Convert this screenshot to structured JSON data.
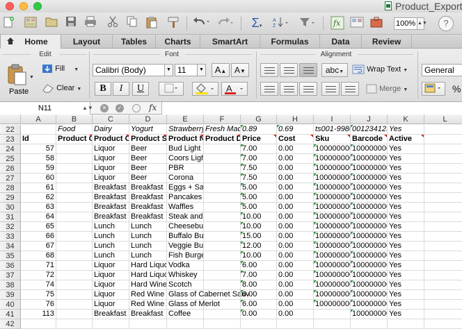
{
  "window": {
    "title": "Product_Export"
  },
  "toolbar": {
    "zoom": "100%"
  },
  "ribbon": {
    "tabs": [
      "Home",
      "Layout",
      "Tables",
      "Charts",
      "SmartArt",
      "Formulas",
      "Data",
      "Review"
    ],
    "active_tab": "Home",
    "edit": {
      "group": "Edit",
      "paste": "Paste",
      "fill": "Fill",
      "clear": "Clear"
    },
    "font": {
      "group": "Font",
      "name": "Calibri (Body)",
      "size": "11",
      "bold": "B",
      "italic": "I",
      "underline": "U"
    },
    "alignment": {
      "group": "Alignment",
      "orientation": "abc",
      "wrap_text": "Wrap Text",
      "merge": "Merge"
    },
    "number": {
      "format": "General",
      "percent": "%"
    }
  },
  "formula_bar": {
    "cell_ref": "N11",
    "formula": ""
  },
  "sheet": {
    "columns": [
      "A",
      "B",
      "C",
      "D",
      "E",
      "F",
      "G",
      "H",
      "I",
      "J",
      "K",
      "L"
    ],
    "rows": [
      {
        "n": "22",
        "cells": [
          "",
          "Food",
          "Dairy",
          "Yogurt",
          "Strawberry",
          "Fresh Made",
          "0.89",
          "0.69",
          "ts001-9980",
          "001234123",
          "Yes",
          ""
        ]
      },
      {
        "n": "23",
        "cells": [
          "Id",
          "Product Cl",
          "Product Ca",
          "Product Su",
          "Product Na",
          "Product De",
          "Price",
          "Cost",
          "Sku",
          "Barcode",
          "Active",
          ""
        ]
      },
      {
        "n": "24",
        "cells": [
          "57",
          "",
          "Liquor",
          "Beer",
          "Bud Light",
          "",
          "7.00",
          "0.00",
          "100000000",
          "100000000",
          "Yes",
          ""
        ]
      },
      {
        "n": "25",
        "cells": [
          "58",
          "",
          "Liquor",
          "Beer",
          "Coors Light",
          "",
          "7.00",
          "0.00",
          "100000000",
          "100000000",
          "Yes",
          ""
        ]
      },
      {
        "n": "26",
        "cells": [
          "59",
          "",
          "Liquor",
          "Beer",
          "PBR",
          "",
          "7.50",
          "0.00",
          "100000000",
          "100000000",
          "Yes",
          ""
        ]
      },
      {
        "n": "27",
        "cells": [
          "60",
          "",
          "Liquor",
          "Beer",
          "Corona",
          "",
          "7.50",
          "0.00",
          "100000000",
          "100000000",
          "Yes",
          ""
        ]
      },
      {
        "n": "28",
        "cells": [
          "61",
          "",
          "Breakfast",
          "Breakfast",
          "Eggs + Sausage",
          "",
          "5.00",
          "0.00",
          "100000000",
          "100000000",
          "Yes",
          ""
        ]
      },
      {
        "n": "29",
        "cells": [
          "62",
          "",
          "Breakfast",
          "Breakfast",
          "Pancakes",
          "",
          "5.00",
          "0.00",
          "100000000",
          "100000000",
          "Yes",
          ""
        ]
      },
      {
        "n": "30",
        "cells": [
          "63",
          "",
          "Breakfast",
          "Breakfast",
          "Waffles",
          "",
          "5.00",
          "0.00",
          "100000000",
          "100000000",
          "Yes",
          ""
        ]
      },
      {
        "n": "31",
        "cells": [
          "64",
          "",
          "Breakfast",
          "Breakfast",
          "Steak and Eggs",
          "",
          "10.00",
          "0.00",
          "100000000",
          "100000000",
          "Yes",
          ""
        ]
      },
      {
        "n": "32",
        "cells": [
          "65",
          "",
          "Lunch",
          "Lunch",
          "Cheeseburger",
          "",
          "10.00",
          "0.00",
          "100000000",
          "100000000",
          "Yes",
          ""
        ]
      },
      {
        "n": "33",
        "cells": [
          "66",
          "",
          "Lunch",
          "Lunch",
          "Buffalo Burger",
          "",
          "15.00",
          "0.00",
          "100000000",
          "100000000",
          "Yes",
          ""
        ]
      },
      {
        "n": "34",
        "cells": [
          "67",
          "",
          "Lunch",
          "Lunch",
          "Veggie Burger",
          "",
          "12.00",
          "0.00",
          "100000000",
          "100000000",
          "Yes",
          ""
        ]
      },
      {
        "n": "35",
        "cells": [
          "68",
          "",
          "Lunch",
          "Lunch",
          "Fish Burger",
          "",
          "10.00",
          "0.00",
          "100000000",
          "100000000",
          "Yes",
          ""
        ]
      },
      {
        "n": "36",
        "cells": [
          "71",
          "",
          "Liquor",
          "Hard Liquo",
          "Vodka",
          "",
          "6.00",
          "0.00",
          "100000000",
          "100000000",
          "Yes",
          ""
        ]
      },
      {
        "n": "37",
        "cells": [
          "72",
          "",
          "Liquor",
          "Hard Liquo",
          "Whiskey",
          "",
          "7.00",
          "0.00",
          "100000000",
          "100000000",
          "Yes",
          ""
        ]
      },
      {
        "n": "38",
        "cells": [
          "74",
          "",
          "Liquor",
          "Hard Wine",
          "Scotch",
          "",
          "8.00",
          "0.00",
          "100000000",
          "100000000",
          "Yes",
          ""
        ]
      },
      {
        "n": "39",
        "cells": [
          "75",
          "",
          "Liquor",
          "Red Wine",
          "Glass of Cabernet Sauv",
          "",
          "6.00",
          "0.00",
          "100000000",
          "100000000",
          "Yes",
          ""
        ]
      },
      {
        "n": "40",
        "cells": [
          "76",
          "",
          "Liquor",
          "Red Wine",
          "Glass of Merlot",
          "",
          "6.00",
          "0.00",
          "100000000",
          "100000000",
          "Yes",
          ""
        ]
      },
      {
        "n": "41",
        "cells": [
          "113",
          "",
          "Breakfast",
          "Breakfast",
          "Coffee",
          "",
          "0.00",
          "0.00",
          "",
          "100000000",
          "Yes",
          ""
        ]
      },
      {
        "n": "42",
        "cells": [
          "",
          "",
          "",
          "",
          "",
          "",
          "",
          "",
          "",
          "",
          "",
          ""
        ]
      }
    ]
  }
}
